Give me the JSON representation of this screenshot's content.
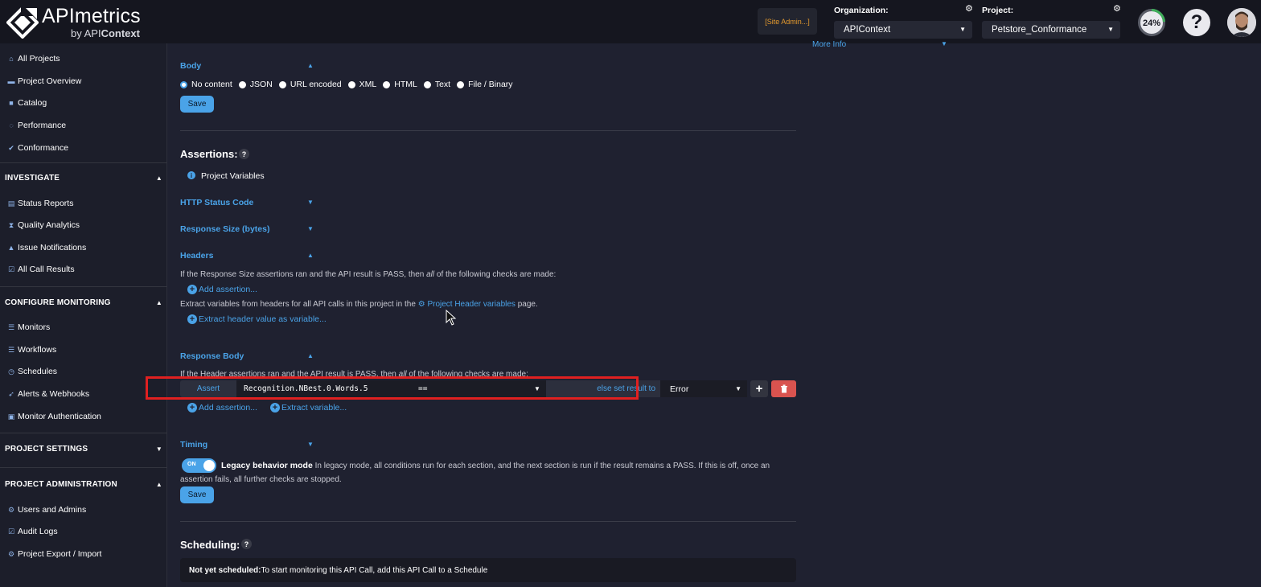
{
  "header": {
    "brand_main": "APImetrics",
    "brand_sub_prefix": "by API",
    "brand_sub_bold": "Context",
    "site_admin": "[Site Admin...]",
    "organization_label": "Organization:",
    "organization_value": "APIContext",
    "project_label": "Project:",
    "project_value": "Petstore_Conformance",
    "progress_text": "24%",
    "progress_value": 24,
    "help_glyph": "?",
    "colors": {
      "accent": "#4aa3e8",
      "admin": "#e59a2e",
      "danger": "#d9534f"
    }
  },
  "sidebar": {
    "top_items": [
      {
        "label": "All Projects",
        "icon": "home-icon"
      },
      {
        "label": "Project Overview",
        "icon": "folder-icon"
      },
      {
        "label": "Catalog",
        "icon": "book-icon"
      },
      {
        "label": "Performance",
        "icon": "gauge-icon"
      },
      {
        "label": "Conformance",
        "icon": "check-icon"
      }
    ],
    "investigate": {
      "title": "INVESTIGATE",
      "items": [
        {
          "label": "Status Reports",
          "icon": "report-icon"
        },
        {
          "label": "Quality Analytics",
          "icon": "hourglass-icon"
        },
        {
          "label": "Issue Notifications",
          "icon": "bell-icon"
        },
        {
          "label": "All Call Results",
          "icon": "checkbox-icon"
        }
      ]
    },
    "configure": {
      "title": "CONFIGURE MONITORING",
      "items": [
        {
          "label": "Monitors",
          "icon": "list-icon"
        },
        {
          "label": "Workflows",
          "icon": "list-icon"
        },
        {
          "label": "Schedules",
          "icon": "clock-icon"
        },
        {
          "label": "Alerts & Webhooks",
          "icon": "rocket-icon"
        },
        {
          "label": "Monitor Authentication",
          "icon": "lock-icon"
        }
      ]
    },
    "project_settings": {
      "title": "PROJECT SETTINGS"
    },
    "administration": {
      "title": "PROJECT ADMINISTRATION",
      "items": [
        {
          "label": "Users and Admins",
          "icon": "gear-icon"
        },
        {
          "label": "Audit Logs",
          "icon": "checkbox-icon"
        },
        {
          "label": "Project Export / Import",
          "icon": "gear-icon"
        }
      ]
    }
  },
  "main": {
    "more_info": "More Info",
    "body": {
      "title": "Body",
      "options": [
        "No content",
        "JSON",
        "URL encoded",
        "XML",
        "HTML",
        "Text",
        "File / Binary"
      ],
      "selected": "No content",
      "save": "Save"
    },
    "assertions": {
      "title": "Assertions:",
      "help": "?",
      "project_variables": "Project Variables",
      "http_status": "HTTP Status Code",
      "response_size": "Response Size (bytes)",
      "headers": {
        "title": "Headers",
        "desc_prefix": "If the Response Size assertions ran and the API result is PASS, then ",
        "desc_em": "all",
        "desc_suffix": " of the following checks are made:",
        "add_assertion": "Add assertion...",
        "extract_prefix": "Extract variables from headers for all API calls in this project in the ",
        "extract_link": "Project Header variables",
        "extract_suffix": " page.",
        "extract_header": "Extract header value as variable..."
      },
      "response_body": {
        "title": "Response Body",
        "desc_prefix": "If the Header assertions ran and the API result is PASS, then ",
        "desc_em": "all",
        "desc_suffix": " of the following checks are made:",
        "assert_label": "Assert",
        "assert_path": "Recognition.NBest.0.Words.5",
        "assert_op": "==",
        "else_label": "else set result to",
        "result_value": "Error",
        "add_assertion": "Add assertion...",
        "extract_variable": "Extract variable..."
      },
      "timing": {
        "title": "Timing",
        "toggle_on": "ON",
        "legacy_label": "Legacy behavior mode",
        "legacy_desc_line1": " In legacy mode, all conditions run for each section, and the next section is run if the result remains a PASS. If this is off, once an",
        "legacy_desc_line2": "assertion fails, all further checks are stopped.",
        "save": "Save"
      }
    },
    "scheduling": {
      "title": "Scheduling:",
      "help": "?",
      "status_bold": "Not yet scheduled:",
      "status_text": " To start monitoring this API Call, add this API Call to a Schedule"
    }
  }
}
